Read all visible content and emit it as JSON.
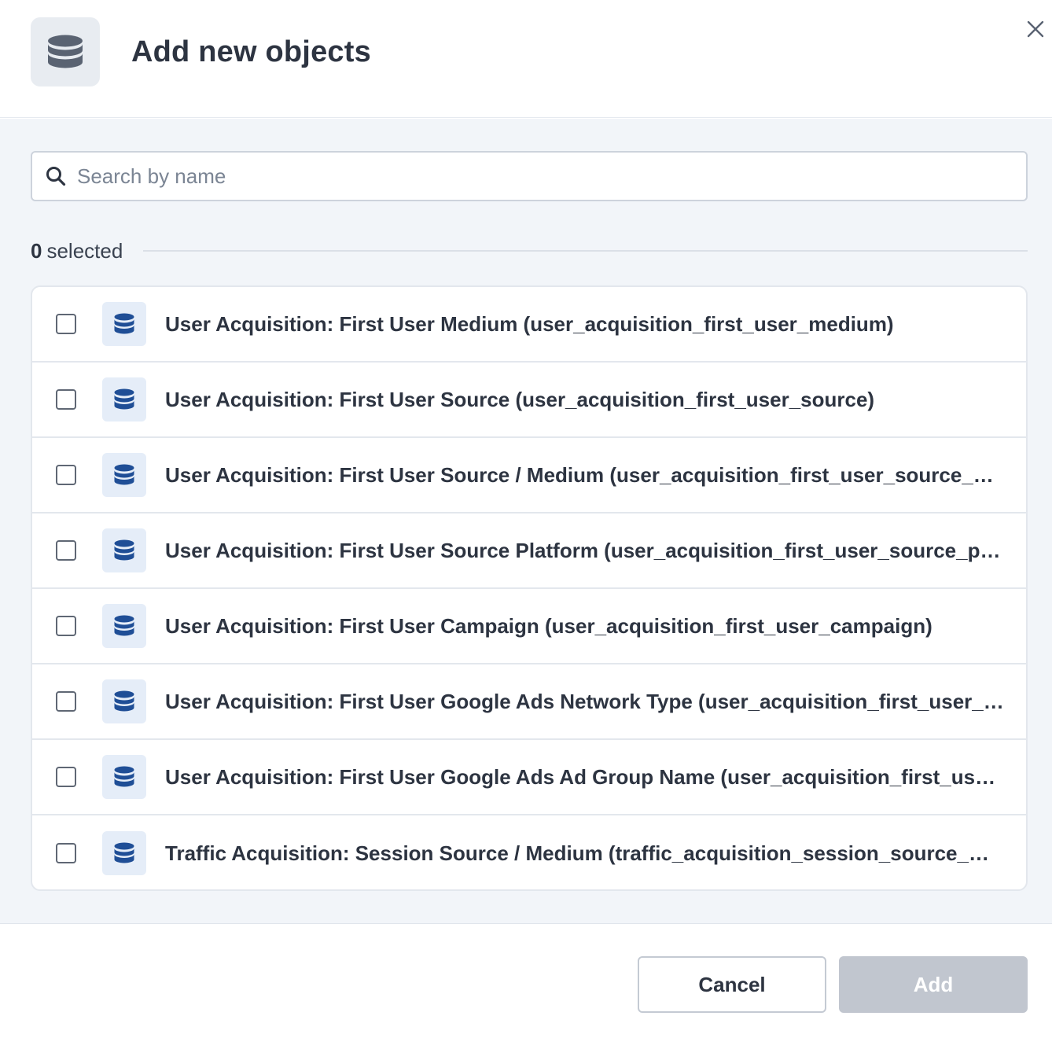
{
  "dialog": {
    "title": "Add new objects",
    "header_icon": "database-icon",
    "close_icon": "close-icon"
  },
  "search": {
    "placeholder": "Search by name",
    "value": "",
    "icon": "search-icon"
  },
  "selection": {
    "count": "0",
    "label": "selected"
  },
  "items": [
    {
      "label": "User Acquisition: First User Medium (user_acquisition_first_user_medium)",
      "checked": false,
      "icon": "database-icon"
    },
    {
      "label": "User Acquisition: First User Source (user_acquisition_first_user_source)",
      "checked": false,
      "icon": "database-icon"
    },
    {
      "label": "User Acquisition: First User Source / Medium (user_acquisition_first_user_source_medium)",
      "checked": false,
      "icon": "database-icon"
    },
    {
      "label": "User Acquisition: First User Source Platform (user_acquisition_first_user_source_platform)",
      "checked": false,
      "icon": "database-icon"
    },
    {
      "label": "User Acquisition: First User Campaign (user_acquisition_first_user_campaign)",
      "checked": false,
      "icon": "database-icon"
    },
    {
      "label": "User Acquisition: First User Google Ads Network Type (user_acquisition_first_user_google_ads_network_type)",
      "checked": false,
      "icon": "database-icon"
    },
    {
      "label": "User Acquisition: First User Google Ads Ad Group Name (user_acquisition_first_user_google_ads_ad_group_name)",
      "checked": false,
      "icon": "database-icon"
    },
    {
      "label": "Traffic Acquisition: Session Source / Medium (traffic_acquisition_session_source_medium)",
      "checked": false,
      "icon": "database-icon"
    }
  ],
  "footer": {
    "cancel_label": "Cancel",
    "add_label": "Add"
  },
  "colors": {
    "icon_blue": "#1f4e96",
    "header_icon_gray": "#5a6372",
    "disabled_button": "#c1c6cf"
  }
}
